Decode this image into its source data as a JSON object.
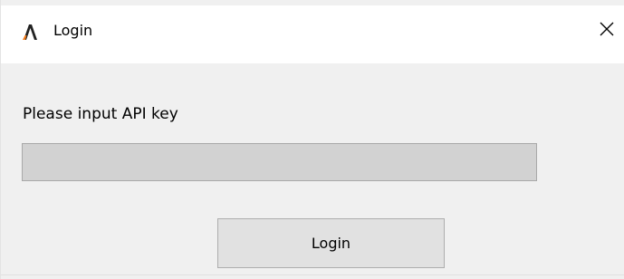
{
  "window": {
    "title": "Login",
    "app_icon": "arrow-a-logo-icon",
    "close_icon": "close-icon"
  },
  "form": {
    "prompt_label": "Please input API key",
    "api_key_value": "",
    "api_key_placeholder": "",
    "login_button_label": "Login"
  },
  "colors": {
    "titlebar_bg": "#ffffff",
    "window_bg": "#f0f0f0",
    "input_bg": "#d2d2d2",
    "button_bg": "#e1e1e1",
    "logo_dark": "#222222",
    "logo_accent": "#f07a1a"
  }
}
